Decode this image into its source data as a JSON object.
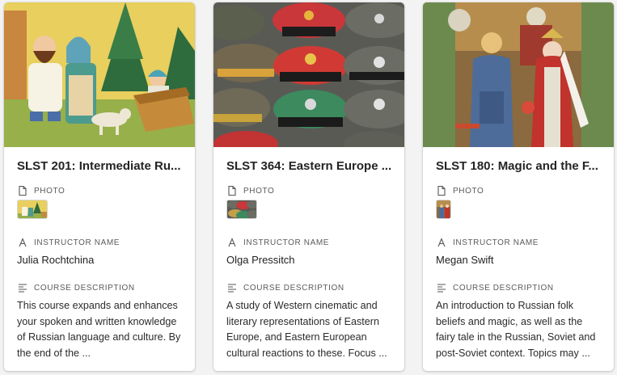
{
  "field_labels": {
    "photo": "PHOTO",
    "instructor": "INSTRUCTOR NAME",
    "description": "COURSE DESCRIPTION"
  },
  "cards": [
    {
      "title": "SLST 201: Intermediate Ru...",
      "instructor": "Julia Rochtchina",
      "description": "This course expands and enhances your spoken and written knowledge of Russian language and culture. By the end of the ..."
    },
    {
      "title": "SLST 364: Eastern Europe ...",
      "instructor": "Olga Pressitch",
      "description": "A study of Western cinematic and literary representations of Eastern Europe, and Eastern European cultural reactions to these. Focus ..."
    },
    {
      "title": "SLST 180: Magic and the F...",
      "instructor": "Megan Swift",
      "description": "An introduction to Russian folk beliefs and magic, as well as the fairy tale in the Russian, Soviet and post-Soviet context. Topics may ..."
    }
  ],
  "icons": {
    "photo": "file-icon",
    "instructor": "text-a-icon",
    "description": "align-left-icon"
  }
}
